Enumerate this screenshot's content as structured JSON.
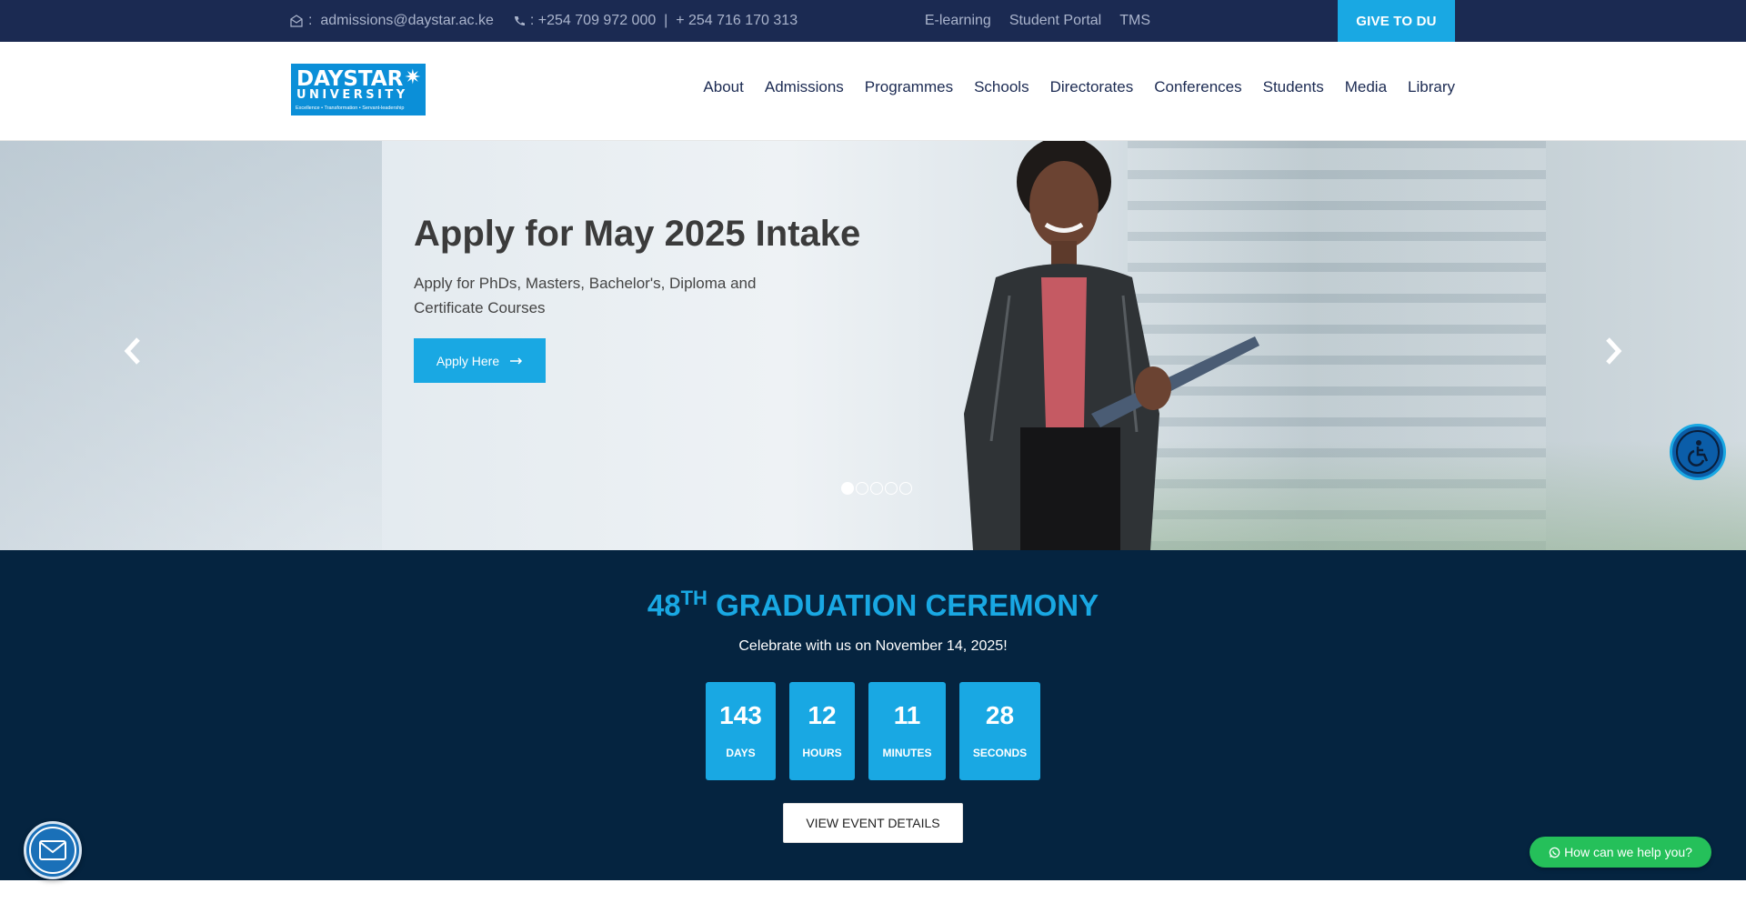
{
  "topbar": {
    "email_sep": ":",
    "email": "admissions@daystar.ac.ke",
    "phone": ": +254 709 972 000",
    "phone_sep": "|",
    "phone2": "+ 254 716 170 313",
    "links": [
      "E-learning",
      "Student Portal",
      "TMS"
    ],
    "give_label": "GIVE TO DU"
  },
  "logo": {
    "line1": "DAYSTAR",
    "line2": "UNIVERSITY",
    "tagline": "Excellence • Transformation • Servant-leadership"
  },
  "nav": {
    "items": [
      "About",
      "Admissions",
      "Programmes",
      "Schools",
      "Directorates",
      "Conferences",
      "Students",
      "Media",
      "Library"
    ]
  },
  "hero": {
    "title": "Apply for May 2025 Intake",
    "subtitle": "Apply for PhDs, Masters, Bachelor's, Diploma and Certificate Courses",
    "apply_label": "Apply Here",
    "slide_count": 5,
    "active_slide": 1
  },
  "graduation": {
    "number": "48",
    "suffix": "TH",
    "title": "GRADUATION CEREMONY",
    "celebrate": "Celebrate with us on November 14, 2025!",
    "countdown": [
      {
        "value": "143",
        "label": "DAYS"
      },
      {
        "value": "12",
        "label": "HOURS"
      },
      {
        "value": "11",
        "label": "MINUTES"
      },
      {
        "value": "28",
        "label": "SECONDS"
      }
    ],
    "view_label": "VIEW EVENT DETAILS"
  },
  "whatsapp": {
    "label": "How can we help you?"
  },
  "colors": {
    "topbar": "#1b2a52",
    "accent": "#19a8e3",
    "section_bg": "#052440",
    "whatsapp": "#25c05a"
  }
}
